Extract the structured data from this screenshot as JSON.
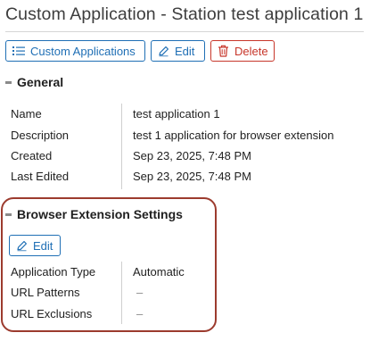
{
  "page": {
    "title": "Custom Application - Station test application 1"
  },
  "toolbar": {
    "custom_apps_label": "Custom Applications",
    "edit_label": "Edit",
    "delete_label": "Delete"
  },
  "general": {
    "header": "General",
    "rows": [
      {
        "label": "Name",
        "value": "test application 1"
      },
      {
        "label": "Description",
        "value": "test 1 application for browser extension"
      },
      {
        "label": "Created",
        "value": "Sep 23, 2025, 7:48 PM"
      },
      {
        "label": "Last Edited",
        "value": "Sep 23, 2025, 7:48 PM"
      }
    ]
  },
  "browser_ext": {
    "header": "Browser Extension Settings",
    "edit_label": "Edit",
    "rows": [
      {
        "label": "Application Type",
        "value": "Automatic"
      },
      {
        "label": "URL Patterns",
        "value": "–"
      },
      {
        "label": "URL Exclusions",
        "value": "–"
      }
    ]
  },
  "colors": {
    "primary": "#1f6fb5",
    "danger": "#c7362a",
    "highlight": "#9c3b2e"
  },
  "icons": [
    "list-icon",
    "pencil-icon",
    "trash-icon",
    "collapse-icon"
  ]
}
